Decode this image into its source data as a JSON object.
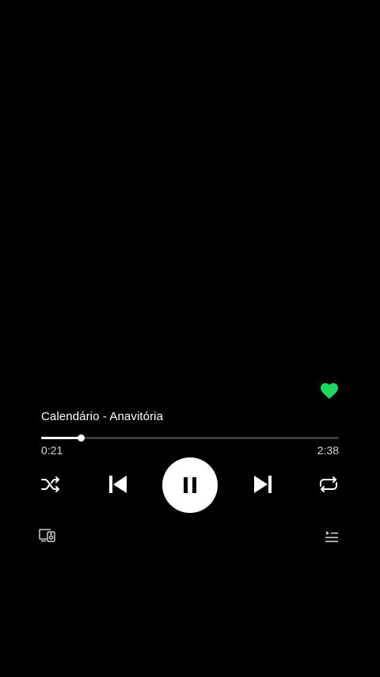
{
  "player": {
    "track_title": "Calendário - Anavitória",
    "liked": true,
    "elapsed": "0:21",
    "total": "2:38",
    "progress_fraction": 0.133,
    "state": "playing"
  },
  "controls": {
    "shuffle_icon": "shuffle-icon",
    "previous_icon": "skip-previous-icon",
    "play_pause_icon": "pause-icon",
    "next_icon": "skip-next-icon",
    "repeat_icon": "repeat-icon",
    "devices_icon": "connect-devices-icon",
    "queue_icon": "queue-icon"
  },
  "colors": {
    "background": "#000000",
    "accent_like": "#1ed760",
    "foreground": "#ffffff",
    "track_inactive": "#3a3a3a"
  }
}
